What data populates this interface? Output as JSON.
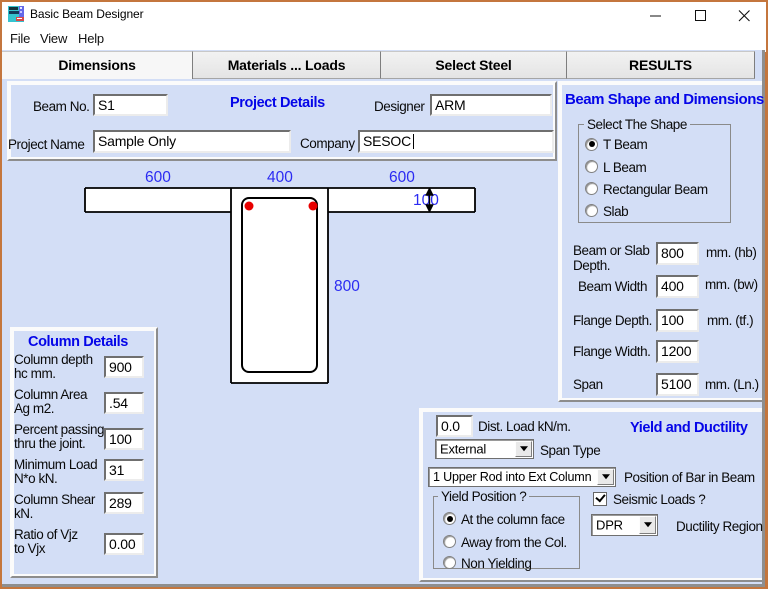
{
  "window": {
    "title": "Basic Beam Designer",
    "icon": "app-icon",
    "border_color": "#c4763d"
  },
  "menu": {
    "file": "File",
    "view": "View",
    "help": "Help"
  },
  "tabs": {
    "dimensions": "Dimensions",
    "materials": "Materials ... Loads",
    "select_steel": "Select Steel",
    "results": "RESULTS",
    "active": "Dimensions"
  },
  "project": {
    "beam_no_label": "Beam No.",
    "beam_no": "S1",
    "title": "Project Details",
    "designer_label": "Designer",
    "designer": "ARM",
    "project_name_label": "Project Name",
    "project_name": "Sample Only",
    "company_label": "Company",
    "company": "SESOC"
  },
  "beam_shape": {
    "title": "Beam Shape and Dimensions",
    "shape_group_title": "Select The Shape",
    "options": {
      "t_beam": "T Beam",
      "l_beam": "L Beam",
      "rect_beam": "Rectangular Beam",
      "slab": "Slab",
      "selected": "T Beam"
    },
    "fields": {
      "depth_label_1": "Beam or Slab",
      "depth_label_2": "Depth.",
      "depth_value": "800",
      "depth_unit": "mm. (hb)",
      "width_label": "Beam Width",
      "width_value": "400",
      "width_unit": "mm. (bw)",
      "flange_depth_label": "Flange Depth.",
      "flange_depth_value": "100",
      "flange_depth_unit": "mm. (tf.)",
      "flange_width_label": "Flange Width.",
      "flange_width_value": "1200",
      "span_label": "Span",
      "span_value": "5100",
      "span_unit": "mm. (Ln.)"
    }
  },
  "drawing": {
    "dim_left": "600",
    "dim_mid": "400",
    "dim_right": "600",
    "dim_flange_thickness": "100",
    "dim_web_depth": "800",
    "rebar_color": "#e80000",
    "dim_color": "#2b2bf2"
  },
  "column_details": {
    "title": "Column Details",
    "rows": [
      {
        "l1": "Column depth",
        "l2": "hc mm.",
        "value": "900"
      },
      {
        "l1": "Column Area",
        "l2": "Ag m2.",
        "value": ".54"
      },
      {
        "l1": "Percent passing",
        "l2": "thru the joint.",
        "value": "100"
      },
      {
        "l1": "Minimum Load",
        "l2": "N*o kN.",
        "value": "31"
      },
      {
        "l1": "Column Shear",
        "l2": "kN.",
        "value": "289"
      },
      {
        "l1": "Ratio of Vjz",
        "l2": "to Vjx",
        "value": "0.00"
      }
    ]
  },
  "yield": {
    "dist_load_value": "0.0",
    "dist_load_label": "Dist. Load kN/m.",
    "title": "Yield and Ductility",
    "span_type_value": "External",
    "span_type_label": "Span Type",
    "bar_position_value": "1 Upper Rod into Ext Column",
    "bar_position_label": "Position of Bar in Beam",
    "yield_group_title": "Yield Position ?",
    "yield_options": {
      "at_face": "At the column face",
      "away": "Away from the Col.",
      "non": "Non Yielding",
      "selected": "At the column face"
    },
    "seismic_label": "Seismic Loads ?",
    "seismic_checked": true,
    "ductility_value": "DPR",
    "ductility_label": "Ductility Region"
  }
}
